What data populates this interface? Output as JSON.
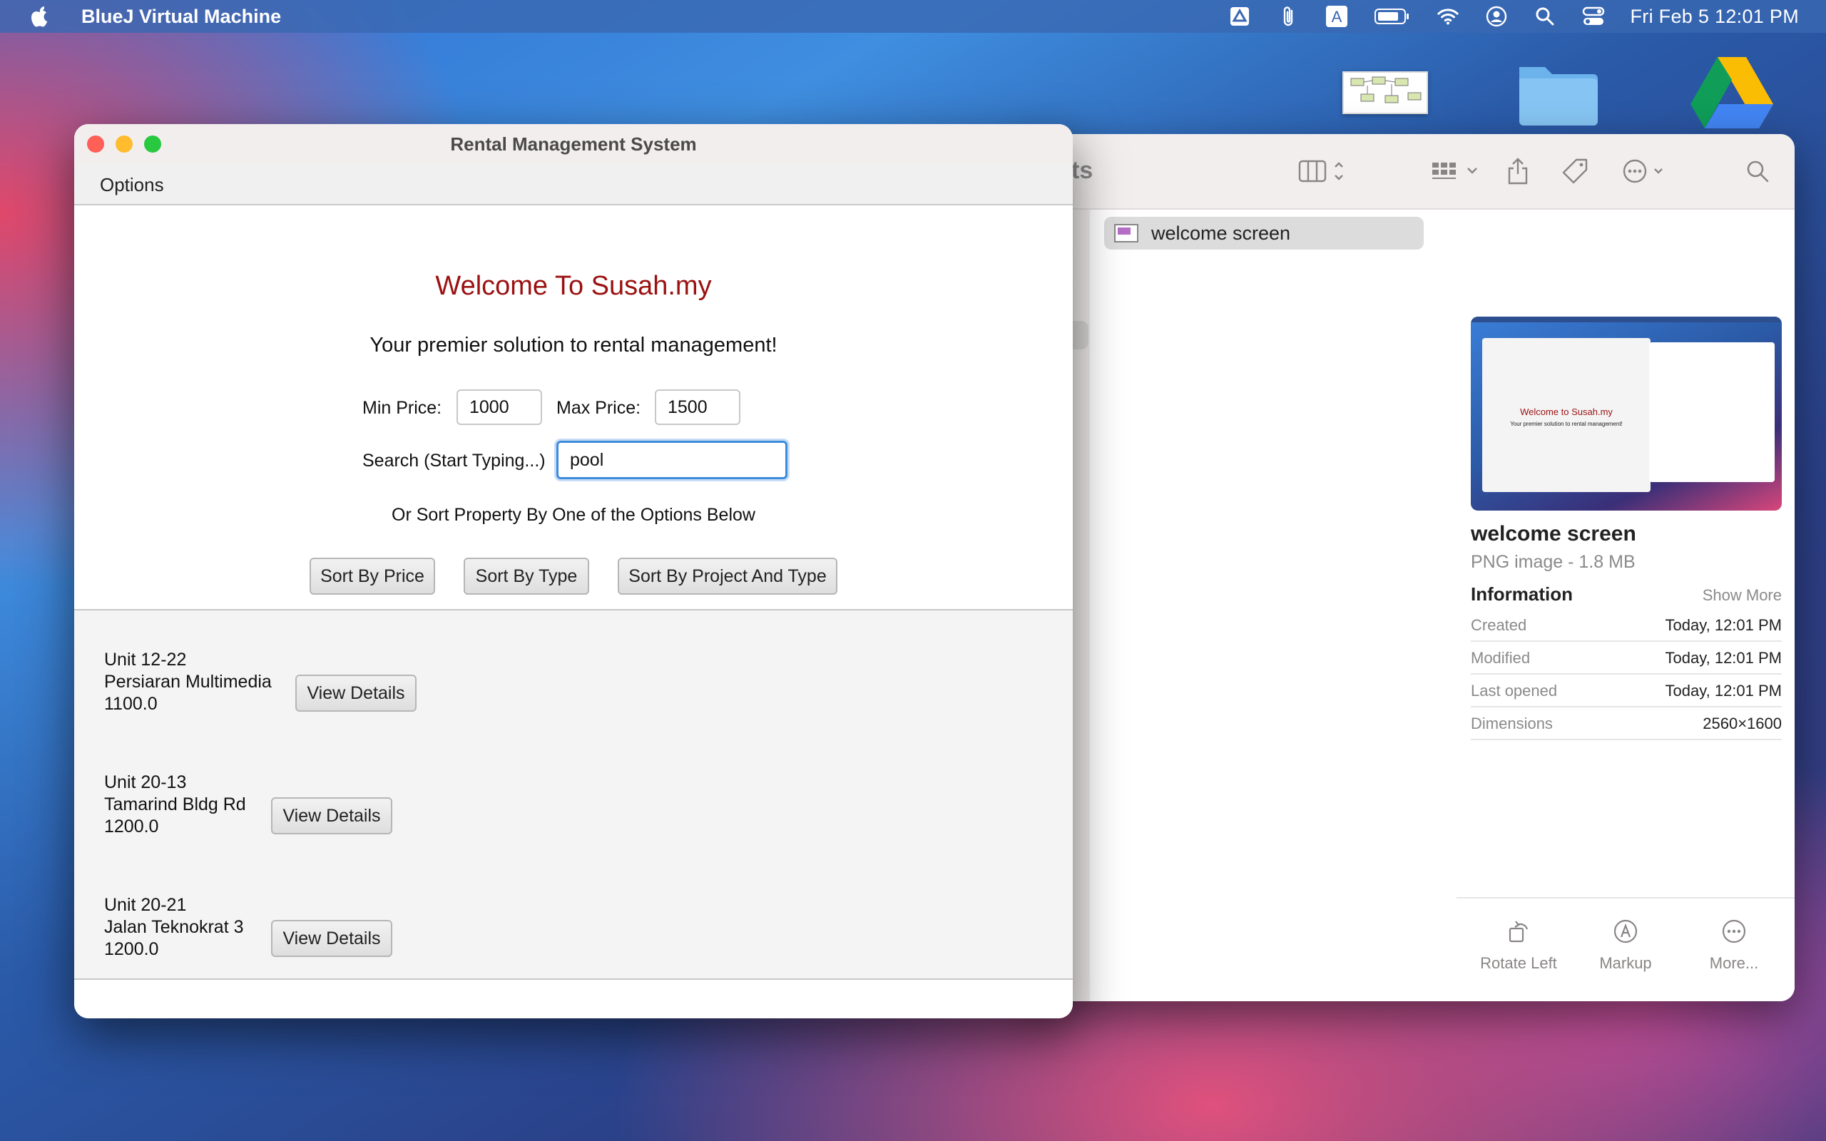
{
  "menubar": {
    "app_name": "BlueJ Virtual Machine",
    "clock": "Fri Feb 5  12:01 PM",
    "icons": [
      "apple-icon",
      "google-drive-status-icon",
      "paperclip-icon",
      "text-input-icon",
      "battery-icon",
      "wifi-icon",
      "user-icon",
      "search-icon",
      "control-center-icon"
    ]
  },
  "app_window": {
    "title": "Rental Management System",
    "menu": {
      "options_label": "Options"
    },
    "welcome": "Welcome To Susah.my",
    "tagline": "Your premier solution to rental management!",
    "filters": {
      "min_price_label": "Min Price:",
      "min_price_value": "1000",
      "max_price_label": "Max Price:",
      "max_price_value": "1500",
      "search_label": "Search (Start Typing...)",
      "search_value": "pool"
    },
    "sort": {
      "prompt": "Or Sort Property By One of the Options Below",
      "buttons": [
        "Sort By Price",
        "Sort By Type",
        "Sort By Project And Type"
      ]
    },
    "results": [
      {
        "unit": "Unit 12-22",
        "street": "Persiaran Multimedia",
        "price": "1100.0",
        "button": "View Details"
      },
      {
        "unit": "Unit 20-13",
        "street": "Tamarind Bldg Rd",
        "price": "1200.0",
        "button": "View Details"
      },
      {
        "unit": "Unit 20-21",
        "street": "Jalan Teknokrat 3",
        "price": "1200.0",
        "button": "View Details"
      }
    ]
  },
  "finder": {
    "title_fragment": "ts",
    "file_name": "welcome screen",
    "preview": {
      "title": "welcome screen",
      "subtitle": "PNG image - 1.8 MB",
      "info_heading": "Information",
      "show_more": "Show More",
      "rows": [
        {
          "key": "Created",
          "value": "Today, 12:01 PM"
        },
        {
          "key": "Modified",
          "value": "Today, 12:01 PM"
        },
        {
          "key": "Last opened",
          "value": "Today, 12:01 PM"
        },
        {
          "key": "Dimensions",
          "value": "2560×1600"
        }
      ],
      "thumb_title": "Welcome to Susah.my",
      "thumb_tagline": "Your premier solution to rental management!"
    },
    "actions": [
      "Rotate Left",
      "Markup",
      "More..."
    ]
  }
}
